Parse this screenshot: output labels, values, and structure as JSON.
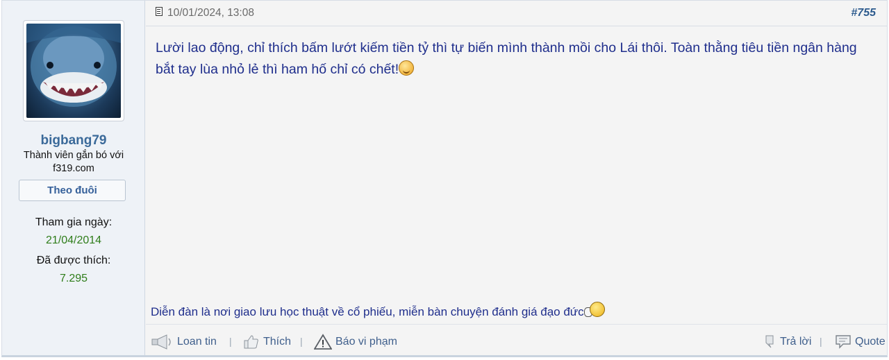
{
  "post": {
    "date": "10/01/2024, 13:08",
    "number": "#755",
    "content": "Lười lao động, chỉ thích bấm lướt kiếm tiền tỷ thì tự biến mình thành mồi cho Lái thôi. Toàn thằng tiêu tiền ngân hàng bắt tay lùa nhỏ lẻ thì ham hố chỉ có chết!",
    "signature": "Diễn đàn là nơi giao lưu học thuật về cổ phiếu, miễn bàn chuyện đánh giá đạo đức"
  },
  "user": {
    "name": "bigbang79",
    "title": "Thành viên gắn bó với f319.com",
    "follow_label": "Theo đuôi",
    "join_label": "Tham gia ngày:",
    "join_date": "21/04/2014",
    "likes_label": "Đã được thích:",
    "likes_count": "7.295"
  },
  "actions": {
    "share": "Loan tin",
    "like": "Thích",
    "report": "Báo vi phạm",
    "reply": "Trả lời",
    "quote": "Quote",
    "separator": "|"
  },
  "icons": {
    "date": "document-icon",
    "share": "megaphone-icon",
    "like": "thumbs-up-icon",
    "report": "warning-icon",
    "reply": "reply-arrow-icon",
    "quote": "speech-bubble-icon",
    "content_smiley": "smiley-icon",
    "signature_smiley": "waving-smiley-icon"
  }
}
